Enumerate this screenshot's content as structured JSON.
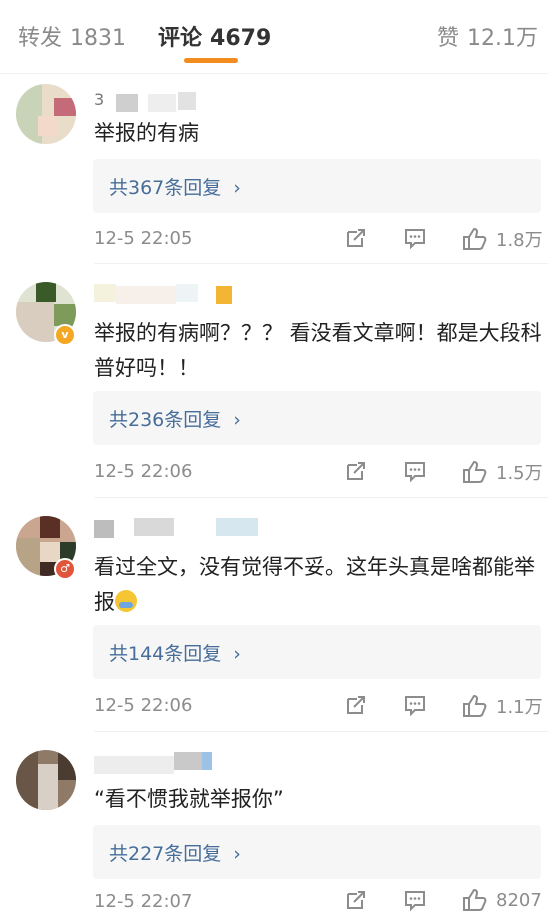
{
  "tabs": {
    "repost_label": "转发",
    "repost_count": "1831",
    "comments_label": "评论",
    "comments_count": "4679",
    "likes_label": "赞",
    "likes_count": "12.1万"
  },
  "comments": [
    {
      "username": "3",
      "text": "举报的有病",
      "replies": "共367条回复",
      "time": "12-5 22:05",
      "likes": "1.8万"
    },
    {
      "username": "",
      "text": "举报的有病啊？？？ 看没看文章啊！都是大段科普好吗！！",
      "replies": "共236条回复",
      "time": "12-5 22:06",
      "likes": "1.5万"
    },
    {
      "username": "",
      "text": "看过全文，没有觉得不妥。这年头真是啥都能举报",
      "replies": "共144条回复",
      "time": "12-5 22:06",
      "likes": "1.1万"
    },
    {
      "username": "",
      "text": "“看不惯我就举报你”",
      "replies": "共227条回复",
      "time": "12-5 22:07",
      "likes": "8207"
    }
  ],
  "colors": {
    "accent": "#f28c1e",
    "link": "#476d9a",
    "meta": "#8c8c8c"
  },
  "icons": [
    "chevron-right-icon",
    "share-icon",
    "comment-icon",
    "like-icon",
    "verified-badge-icon",
    "emoji-icon"
  ]
}
